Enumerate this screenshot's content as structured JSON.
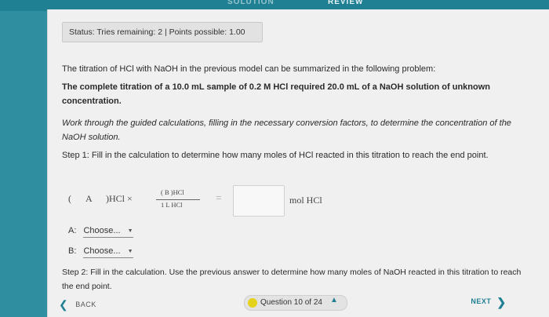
{
  "nav": {
    "tab_solution": "SOLUTION",
    "tab_review": "REVIEW"
  },
  "status": {
    "text": "Status: Tries remaining: 2 | Points possible: 1.00"
  },
  "problem": {
    "intro": "The titration of HCl with NaOH in the previous model can be summarized in the following problem:",
    "bold_statement": "The complete titration of a 10.0 mL sample of 0.2 M HCl required 20.0 mL of a NaOH solution of unknown concentration.",
    "instructions": "Work through the guided calculations, filling in the necessary conversion factors, to determine the concentration of the NaOH solution.",
    "step1": "Step 1: Fill in the calculation to determine how many moles of HCl reacted in this titration to reach the end point.",
    "step2": "Step 2: Fill in the calculation. Use the previous answer to determine how many moles of NaOH reacted in this titration to reach the end point."
  },
  "equation": {
    "open_paren_a": "(",
    "label_a": "A",
    "close_a": ")HCl ×",
    "frac_top": "(   B   )HCl",
    "frac_bottom": "1 L HCl",
    "equals": "=",
    "unit": "mol HCl"
  },
  "choices": {
    "a_label": "A:",
    "a_value": "Choose...",
    "b_label": "B:",
    "b_value": "Choose..."
  },
  "footer": {
    "back": "BACK",
    "question": "Question 10 of 24",
    "next": "NEXT"
  }
}
